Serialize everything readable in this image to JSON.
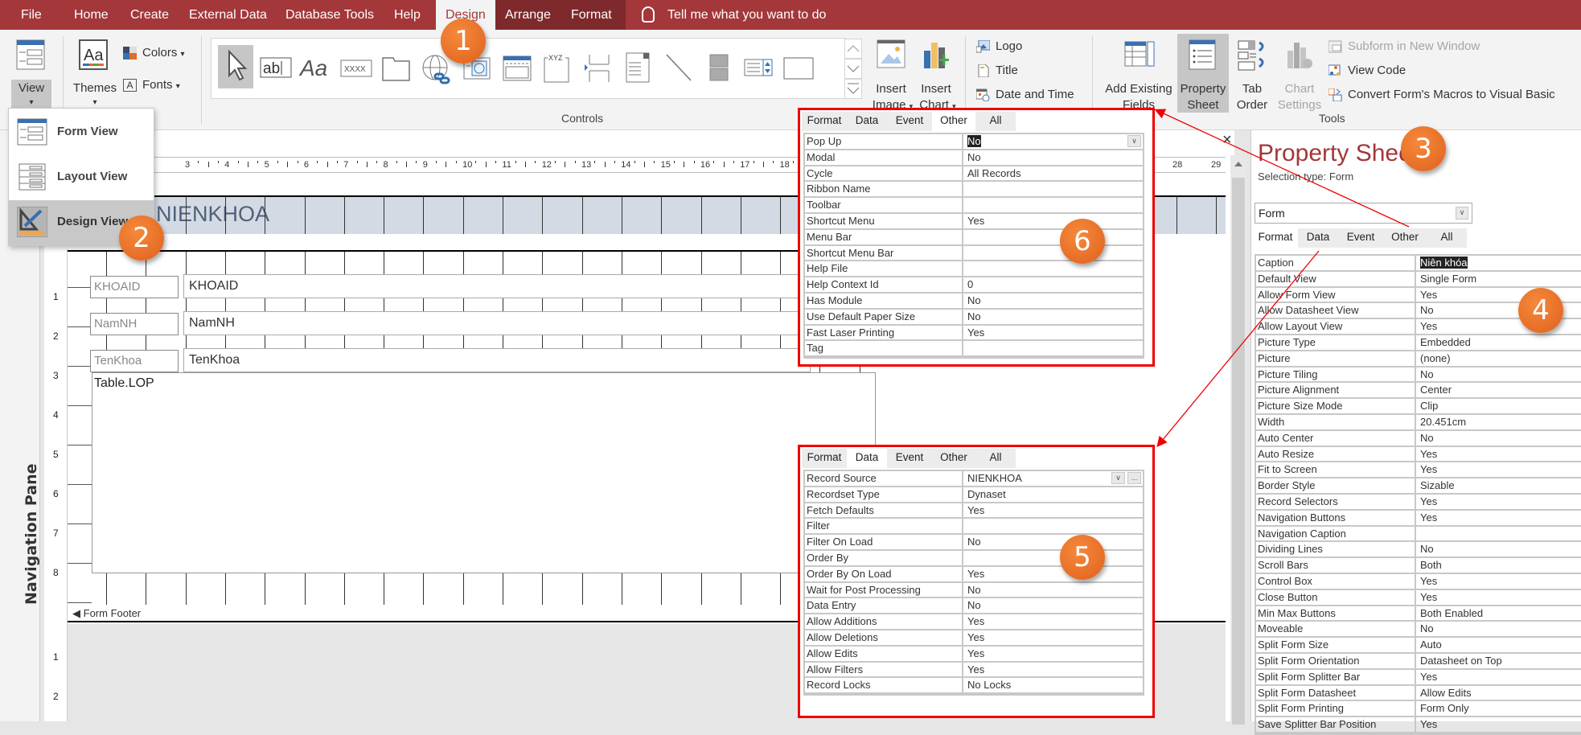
{
  "menubar": {
    "tabs": [
      "File",
      "Home",
      "Create",
      "External Data",
      "Database Tools",
      "Help",
      "Design",
      "Arrange",
      "Format"
    ],
    "active_tab": "Design",
    "tell_me": "Tell me what you want to do"
  },
  "ribbon": {
    "views": {
      "view_label": "View"
    },
    "themes": {
      "themes_label": "Themes",
      "colors_label": "Colors",
      "fonts_label": "Fonts"
    },
    "controls": {
      "group_label": "Controls",
      "items": [
        "select-pointer",
        "text-box",
        "label",
        "button",
        "tab-control",
        "hyperlink",
        "web-browser",
        "navigation-control",
        "option-group",
        "page-break",
        "combo-box",
        "line",
        "toggle-button",
        "list-box",
        "rectangle"
      ],
      "text_box_glyph": "ab|",
      "label_glyph": "Aa",
      "button_glyph": "XXXX",
      "option_group_glyph": "XYZ"
    },
    "insert_image": {
      "line1": "Insert",
      "line2": "Image"
    },
    "insert_chart": {
      "line1": "Insert",
      "line2": "Chart"
    },
    "header_footer": {
      "logo": "Logo",
      "title": "Title",
      "date_time": "Date and Time"
    },
    "tools": {
      "group_label": "Tools",
      "add_existing_fields": {
        "line1": "Add Existing",
        "line2": "Fields"
      },
      "property_sheet": {
        "line1": "Property",
        "line2": "Sheet"
      },
      "tab_order": {
        "line1": "Tab",
        "line2": "Order"
      },
      "chart_settings": {
        "line1": "Chart",
        "line2": "Settings"
      },
      "subform_new_window": "Subform in New Window",
      "view_code": "View Code",
      "convert_macros": "Convert Form's Macros to Visual Basic"
    }
  },
  "view_menu": {
    "items": [
      {
        "label": "Form View",
        "accesskey": "F"
      },
      {
        "label": "Layout View",
        "accesskey": "y"
      },
      {
        "label": "Design View",
        "accesskey": "D"
      }
    ],
    "selected": "Design View"
  },
  "navigation_pane": {
    "label": "Navigation Pane"
  },
  "design": {
    "ruler_h": [
      "3",
      "4",
      "5",
      "6",
      "7",
      "8",
      "9",
      "10",
      "11",
      "12",
      "13",
      "14",
      "15",
      "16",
      "17",
      "18",
      "28",
      "29"
    ],
    "ruler_v_detail": [
      "1",
      "2",
      "3",
      "4",
      "5",
      "6",
      "7",
      "8"
    ],
    "ruler_v_footer": [
      "1",
      "2"
    ],
    "header_title": "NIENKHOA",
    "fields": [
      {
        "label": "KHOAID",
        "control": "KHOAID"
      },
      {
        "label": "NamNH",
        "control": "NamNH"
      },
      {
        "label": "TenKhoa",
        "control": "TenKhoa"
      }
    ],
    "subform": "Table.LOP",
    "footer_label": "Form Footer",
    "close_glyph": "×"
  },
  "panel_other": {
    "tabs": [
      "Format",
      "Data",
      "Event",
      "Other",
      "All"
    ],
    "active_tab": "Other",
    "rows": [
      {
        "k": "Pop Up",
        "v": "No"
      },
      {
        "k": "Modal",
        "v": "No"
      },
      {
        "k": "Cycle",
        "v": "All Records"
      },
      {
        "k": "Ribbon Name",
        "v": ""
      },
      {
        "k": "Toolbar",
        "v": ""
      },
      {
        "k": "Shortcut Menu",
        "v": "Yes"
      },
      {
        "k": "Menu Bar",
        "v": ""
      },
      {
        "k": "Shortcut Menu Bar",
        "v": ""
      },
      {
        "k": "Help File",
        "v": ""
      },
      {
        "k": "Help Context Id",
        "v": "0"
      },
      {
        "k": "Has Module",
        "v": "No"
      },
      {
        "k": "Use Default Paper Size",
        "v": "No"
      },
      {
        "k": "Fast Laser Printing",
        "v": "Yes"
      },
      {
        "k": "Tag",
        "v": ""
      }
    ]
  },
  "panel_data": {
    "tabs": [
      "Format",
      "Data",
      "Event",
      "Other",
      "All"
    ],
    "active_tab": "Data",
    "rows": [
      {
        "k": "Record Source",
        "v": "NIENKHOA"
      },
      {
        "k": "Recordset Type",
        "v": "Dynaset"
      },
      {
        "k": "Fetch Defaults",
        "v": "Yes"
      },
      {
        "k": "Filter",
        "v": ""
      },
      {
        "k": "Filter On Load",
        "v": "No"
      },
      {
        "k": "Order By",
        "v": ""
      },
      {
        "k": "Order By On Load",
        "v": "Yes"
      },
      {
        "k": "Wait for Post Processing",
        "v": "No"
      },
      {
        "k": "Data Entry",
        "v": "No"
      },
      {
        "k": "Allow Additions",
        "v": "Yes"
      },
      {
        "k": "Allow Deletions",
        "v": "Yes"
      },
      {
        "k": "Allow Edits",
        "v": "Yes"
      },
      {
        "k": "Allow Filters",
        "v": "Yes"
      },
      {
        "k": "Record Locks",
        "v": "No Locks"
      }
    ],
    "builder_glyph": "..."
  },
  "property_sheet": {
    "title": "Property Sheet",
    "selection_type": "Selection type:  Form",
    "selected_object": "Form",
    "tabs": [
      "Format",
      "Data",
      "Event",
      "Other",
      "All"
    ],
    "active_tab": "Format",
    "rows": [
      {
        "k": "Caption",
        "v": "Niên khóa"
      },
      {
        "k": "Default View",
        "v": "Single Form"
      },
      {
        "k": "Allow Form View",
        "v": "Yes"
      },
      {
        "k": "Allow Datasheet View",
        "v": "No"
      },
      {
        "k": "Allow Layout View",
        "v": "Yes"
      },
      {
        "k": "Picture Type",
        "v": "Embedded"
      },
      {
        "k": "Picture",
        "v": "(none)"
      },
      {
        "k": "Picture Tiling",
        "v": "No"
      },
      {
        "k": "Picture Alignment",
        "v": "Center"
      },
      {
        "k": "Picture Size Mode",
        "v": "Clip"
      },
      {
        "k": "Width",
        "v": "20.451cm"
      },
      {
        "k": "Auto Center",
        "v": "No"
      },
      {
        "k": "Auto Resize",
        "v": "Yes"
      },
      {
        "k": "Fit to Screen",
        "v": "Yes"
      },
      {
        "k": "Border Style",
        "v": "Sizable"
      },
      {
        "k": "Record Selectors",
        "v": "Yes"
      },
      {
        "k": "Navigation Buttons",
        "v": "Yes"
      },
      {
        "k": "Navigation Caption",
        "v": ""
      },
      {
        "k": "Dividing Lines",
        "v": "No"
      },
      {
        "k": "Scroll Bars",
        "v": "Both"
      },
      {
        "k": "Control Box",
        "v": "Yes"
      },
      {
        "k": "Close Button",
        "v": "Yes"
      },
      {
        "k": "Min Max Buttons",
        "v": "Both Enabled"
      },
      {
        "k": "Moveable",
        "v": "No"
      },
      {
        "k": "Split Form Size",
        "v": "Auto"
      },
      {
        "k": "Split Form Orientation",
        "v": "Datasheet on Top"
      },
      {
        "k": "Split Form Splitter Bar",
        "v": "Yes"
      },
      {
        "k": "Split Form Datasheet",
        "v": "Allow Edits"
      },
      {
        "k": "Split Form Printing",
        "v": "Form Only"
      },
      {
        "k": "Save Splitter Bar Position",
        "v": "Yes"
      }
    ]
  },
  "callouts": [
    "1",
    "2",
    "3",
    "4",
    "5",
    "6"
  ],
  "colors": {
    "accent": "#a4373a",
    "callout": "#ee7128",
    "highlight_box": "#e00000"
  }
}
